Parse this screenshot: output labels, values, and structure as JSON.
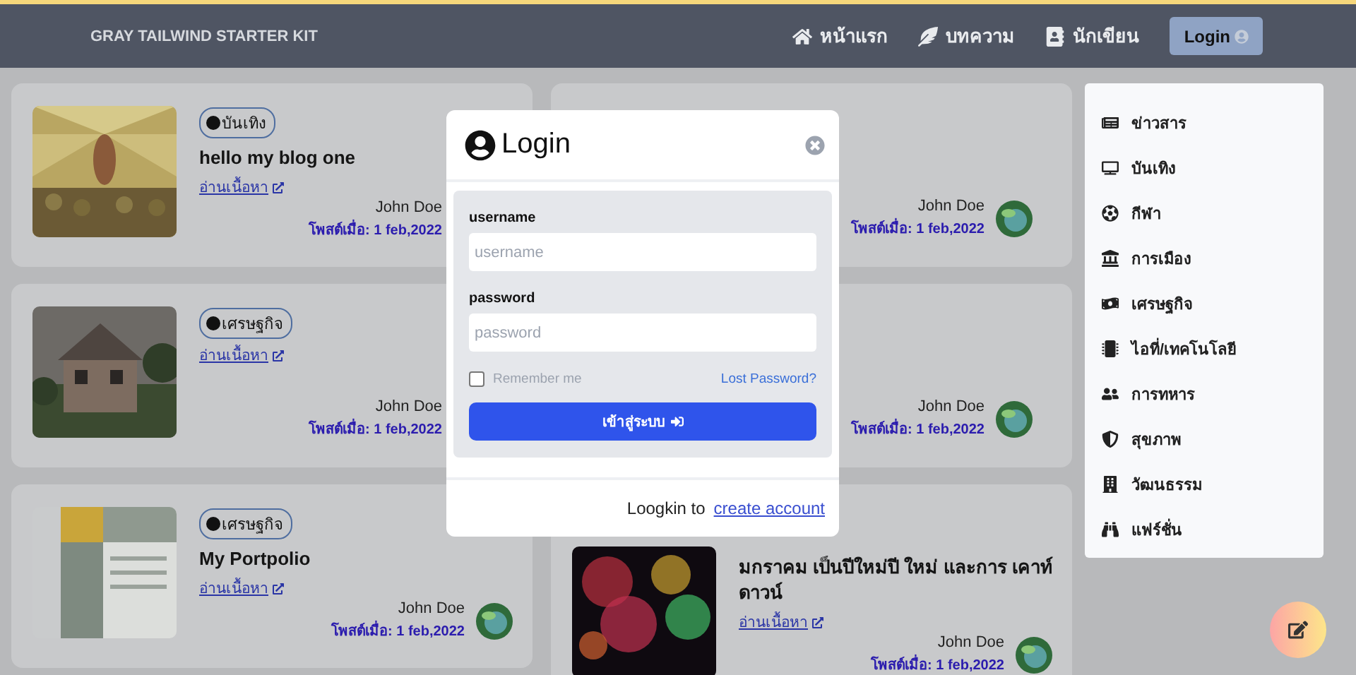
{
  "navbar": {
    "brand": "GRAY TAILWIND STARTER KIT",
    "links": [
      {
        "label": "หน้าแรก"
      },
      {
        "label": "บทความ"
      },
      {
        "label": "นักเขียน"
      }
    ],
    "login_button": "Login"
  },
  "posts_left": [
    {
      "kind": "picture",
      "tag": "บันเทิง",
      "title": "hello my blog one",
      "link": "อ่านเนื้อหา",
      "author": "John Doe",
      "date": "โพสต์เมื่อ: 1 feb,2022",
      "avatar": false
    },
    {
      "kind": "picture",
      "tag": "เศรษฐกิจ",
      "link": "อ่านเนื้อหา",
      "author": "John Doe",
      "date": "โพสต์เมื่อ: 1 feb,2022",
      "avatar": false
    },
    {
      "kind": "picture",
      "tag": "เศรษฐกิจ",
      "title": "My Portpolio",
      "link": "อ่านเนื้อหา",
      "author": "John Doe",
      "date": "โพสต์เมื่อ: 1 feb,2022",
      "avatar": true
    }
  ],
  "posts_right": [
    {
      "author": "John Doe",
      "date": "โพสต์เมื่อ: 1 feb,2022",
      "avatar": true
    },
    {
      "author": "John Doe",
      "date": "โพสต์เมื่อ: 1 feb,2022",
      "avatar": true
    },
    {
      "kind": "picture",
      "title": "มกราคม เป็นปีใหม่ปี ใหม่ และการ เคาท์ดาวน์",
      "link": "อ่านเนื้อหา",
      "author": "John Doe",
      "date": "โพสต์เมื่อ: 1 feb,2022",
      "avatar": true
    }
  ],
  "sidebar": {
    "items": [
      {
        "label": "ข่าวสาร"
      },
      {
        "label": "บันเทิง"
      },
      {
        "label": "กีฬา"
      },
      {
        "label": "การเมือง"
      },
      {
        "label": "เศรษฐกิจ"
      },
      {
        "label": "ไอที่/เทคโนโลยี"
      },
      {
        "label": "การทหาร"
      },
      {
        "label": "สุขภาพ"
      },
      {
        "label": "วัฒนธรรม"
      },
      {
        "label": "แฟร์ชั่น"
      }
    ]
  },
  "login_modal": {
    "title": "Login",
    "fields": [
      {
        "label": "username",
        "placeholder": "username"
      },
      {
        "label": "password",
        "placeholder": "password"
      }
    ],
    "remember": {
      "label": "Remember me",
      "checked": false
    },
    "lost_password": "Lost Password?",
    "submit": "เข้าสู่ระบบ",
    "footer_text": "Loogkin to",
    "footer_link": "create account"
  }
}
